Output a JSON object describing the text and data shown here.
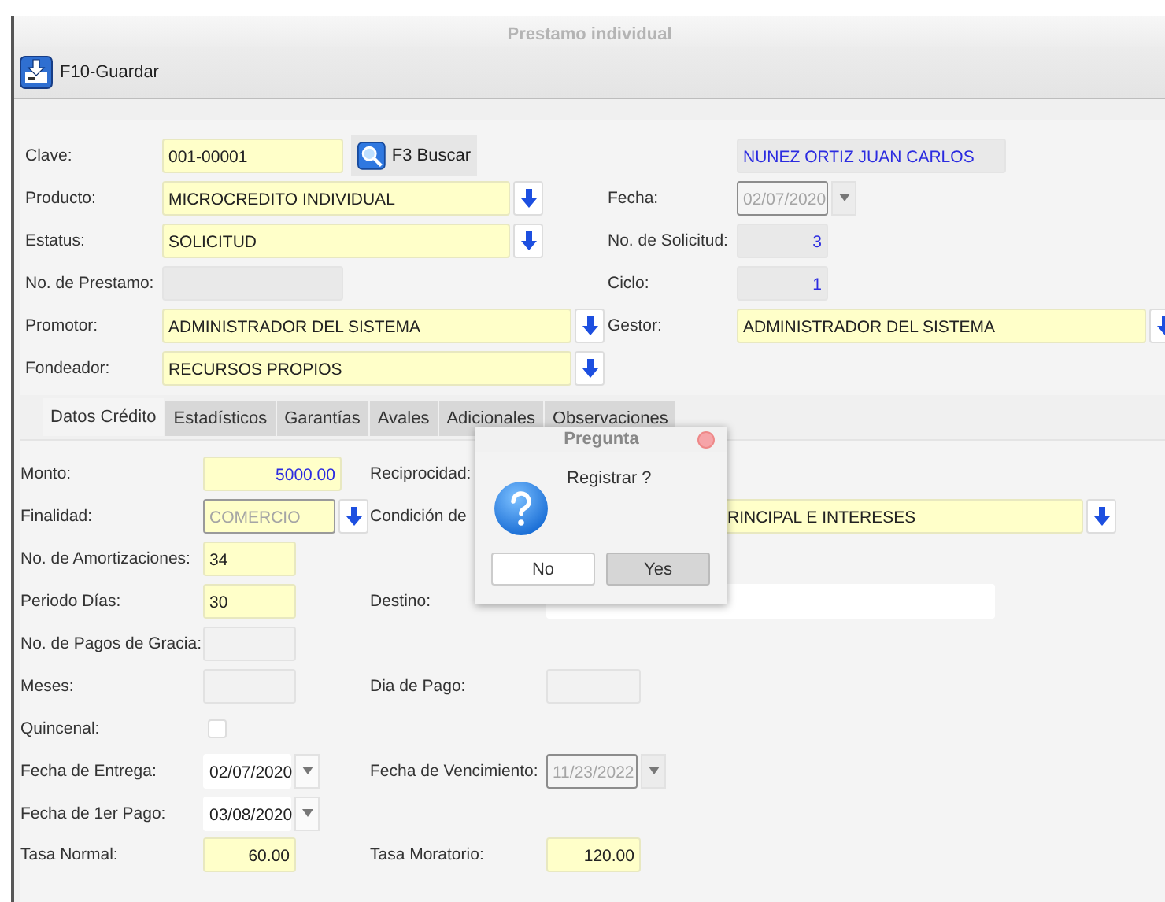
{
  "window": {
    "title": "Prestamo individual"
  },
  "toolbar": {
    "save_button": "F10-Guardar"
  },
  "header": [
    {
      "left_label": "Clave:",
      "left": [
        {
          "kind": "text",
          "value": "001-00001",
          "required": true
        },
        {
          "kind": "button",
          "label": "F3 Buscar"
        }
      ],
      "right": [
        {
          "kind": "text",
          "value": "NUNEZ ORTIZ JUAN CARLOS",
          "required": false,
          "readonly": true,
          "emphasis": true
        }
      ]
    },
    {
      "left_label": "Producto:",
      "left": [
        {
          "kind": "combo",
          "value": "MICROCREDITO INDIVIDUAL",
          "required": true,
          "disabled": false
        }
      ],
      "right_label": "Fecha:",
      "right": [
        {
          "kind": "date",
          "value": "02/07/2020",
          "disabled": true
        }
      ]
    },
    {
      "left_label": "Estatus:",
      "left": [
        {
          "kind": "combo",
          "value": "SOLICITUD",
          "required": true,
          "disabled": false
        }
      ],
      "right_label": "No. de Solicitud:",
      "right": [
        {
          "kind": "text",
          "value": "3",
          "required": false,
          "readonly": true,
          "emphasis": true,
          "numeric": true
        }
      ]
    },
    {
      "left_label": "No. de Prestamo:",
      "left": [
        {
          "kind": "text",
          "required": false,
          "readonly": true
        }
      ],
      "right_label": "Ciclo:",
      "right": [
        {
          "kind": "text",
          "value": "1",
          "required": false,
          "readonly": true,
          "emphasis": true,
          "numeric": true
        }
      ]
    },
    {
      "left_label": "Promotor:",
      "left": [
        {
          "kind": "combo",
          "value": "ADMINISTRADOR DEL SISTEMA",
          "required": true,
          "disabled": false
        }
      ],
      "right_label": "Gestor:",
      "right": [
        {
          "kind": "combo",
          "value": "ADMINISTRADOR DEL SISTEMA",
          "required": true,
          "disabled": false
        }
      ]
    },
    {
      "left_label": "Fondeador:",
      "left": [
        {
          "kind": "combo",
          "value": "RECURSOS PROPIOS",
          "required": true,
          "disabled": false
        }
      ]
    }
  ],
  "tabs": [
    {
      "label": "Datos Crédito",
      "selected": true
    },
    {
      "label": "Estadísticos",
      "selected": false
    },
    {
      "label": "Garantías",
      "selected": false
    },
    {
      "label": "Avales",
      "selected": false
    },
    {
      "label": "Adicionales",
      "selected": false
    },
    {
      "label": "Observaciones",
      "selected": false
    }
  ],
  "credit": [
    {
      "left_label": "Monto:",
      "left": [
        {
          "kind": "text",
          "value": "5000.00",
          "required": true,
          "emphasis": true,
          "numeric": true
        }
      ],
      "right_label": "Reciprocidad:"
    },
    {
      "left_label": "Finalidad:",
      "left": [
        {
          "kind": "combo",
          "value": "COMERCIO",
          "required": true,
          "disabled": true
        }
      ],
      "right_label": "Condición de",
      "right": [
        {
          "kind": "combo",
          "value": "RINCIPAL E INTERESES",
          "required": true,
          "disabled": false
        }
      ]
    },
    {
      "left_label": "No. de Amortizaciones:",
      "left": [
        {
          "kind": "text",
          "value": "34",
          "required": true
        }
      ]
    },
    {
      "left_label": "Periodo Días:",
      "left": [
        {
          "kind": "text",
          "value": "30",
          "required": true
        }
      ],
      "right_label": "Destino:",
      "right": [
        {
          "kind": "text",
          "required": false
        }
      ]
    },
    {
      "left_label": "No. de Pagos de Gracia:",
      "left": [
        {
          "kind": "text",
          "required": false,
          "disabled": true
        }
      ]
    },
    {
      "left_label": "Meses:",
      "left": [
        {
          "kind": "text",
          "required": false,
          "disabled": true
        }
      ],
      "right_label": "Dia de Pago:",
      "right": [
        {
          "kind": "text",
          "required": false,
          "disabled": true
        }
      ]
    },
    {
      "left_label": "Quincenal:",
      "left": [
        {
          "kind": "check",
          "checked": false
        }
      ]
    },
    {
      "left_label": "Fecha de Entrega:",
      "left": [
        {
          "kind": "date",
          "value": "02/07/2020",
          "disabled": false
        }
      ],
      "right_label": "Fecha de Vencimiento:",
      "right": [
        {
          "kind": "date",
          "value": "11/23/2022",
          "disabled": true
        }
      ]
    },
    {
      "left_label": "Fecha de 1er Pago:",
      "left": [
        {
          "kind": "date",
          "value": "03/08/2020",
          "disabled": false
        }
      ]
    },
    {
      "left_label": "Tasa Normal:",
      "left": [
        {
          "kind": "text",
          "value": "60.00",
          "required": true,
          "numeric": true
        }
      ],
      "right_label": "Tasa Moratorio:",
      "right": [
        {
          "kind": "text",
          "value": "120.00",
          "required": true,
          "numeric": true
        }
      ]
    }
  ],
  "dialog": {
    "title": "Pregunta",
    "message": "Registrar ?",
    "buttons": [
      {
        "label": "No",
        "default": false
      },
      {
        "label": "Yes",
        "default": true
      }
    ]
  }
}
